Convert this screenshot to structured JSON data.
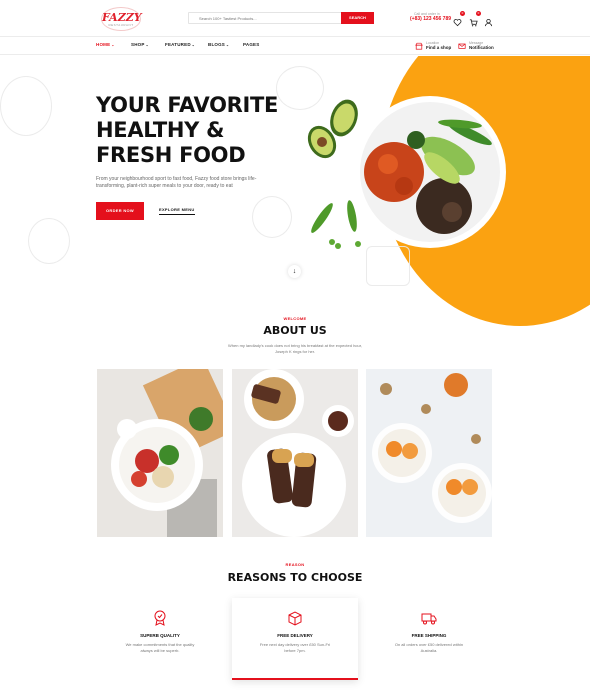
{
  "brand": {
    "name": "FAZZY",
    "tagline": "RESTAURANT"
  },
  "search": {
    "placeholder": "Search 100+ Tastiest Products...",
    "button_label": "SEARCH"
  },
  "contact": {
    "label": "Call and order in",
    "number": "(+83) 123 456 789"
  },
  "header_icons": {
    "wishlist_count": "0",
    "cart_count": "0"
  },
  "nav": {
    "items": [
      {
        "label": "HOME",
        "caret": "⌄"
      },
      {
        "label": "SHOP",
        "caret": "⌄"
      },
      {
        "label": "FEATURED",
        "caret": "⌄"
      },
      {
        "label": "BLOGS",
        "caret": "⌄"
      },
      {
        "label": "PAGES",
        "caret": ""
      }
    ],
    "location": {
      "label": "Location",
      "value": "Find a shop"
    },
    "message": {
      "label": "Message",
      "value": "Notification"
    }
  },
  "hero": {
    "title_line1": "YOUR FAVORITE",
    "title_line2": "HEALTHY &",
    "title_line3": "FRESH FOOD",
    "description": "From your neighbourhood sport to fast food, Fazzy food store brings life-transforming, plant-rich super meals to your door, ready to eat",
    "order_button": "ORDER NOW",
    "explore_button": "EXPLORE MENU",
    "scroll_icon": "arrow-down-icon",
    "accent_color": "#fba211"
  },
  "about": {
    "eyebrow": "WELCOME",
    "title": "ABOUT US",
    "description": "When my landlady's cook does not bring his breakfast at the expected hour, Joseph K rings for her."
  },
  "reasons": {
    "eyebrow": "REASON",
    "title": "REASONS TO CHOOSE",
    "cards": [
      {
        "icon": "quality-badge-icon",
        "title": "SUPERB QUALITY",
        "text": "We make commitments that the quality always will be superb."
      },
      {
        "icon": "delivery-box-icon",
        "title": "FREE DELIVERY",
        "text": "Free next day delivery over £50 Sun-Fri before 7pm."
      },
      {
        "icon": "shipping-truck-icon",
        "title": "FREE SHIPPING",
        "text": "On all orders over £50 delivered within Australia."
      }
    ]
  },
  "colors": {
    "primary": "#e4101c",
    "accent": "#fba211",
    "text": "#111111"
  }
}
